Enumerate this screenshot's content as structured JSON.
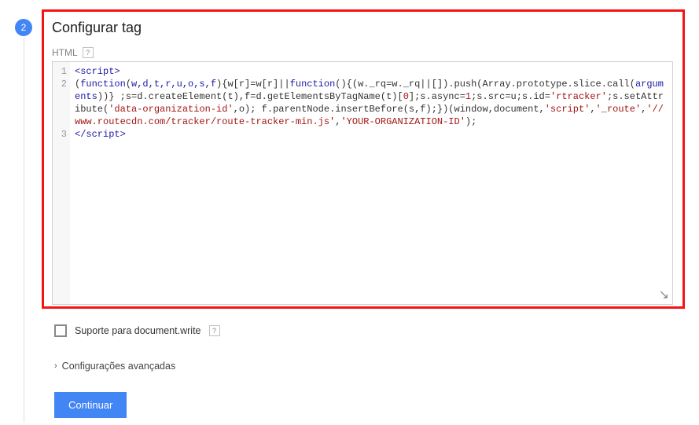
{
  "step_number": "2",
  "title": "Configurar tag",
  "html_label": "HTML",
  "help_glyph": "?",
  "code": {
    "line1": {
      "open": "<script>"
    },
    "line2": {
      "p1": "(",
      "kw1": "function",
      "p2": "(",
      "args": "w,d,t,r,u,o,s,f",
      "p3": "){w[r]=w[r]||",
      "kw2": "function",
      "p4": "(){(w._rq=w._rq||[]).push(Array.prototype.slice.call(",
      "arg_kw": "arguments",
      "p5": "))} ;s=d.createElement(t),f=d.getElementsByTagName(t)[",
      "num0": "0",
      "p5b": "];s.async=",
      "num1": "1",
      "p5c": ";s.src=u;s.id=",
      "str1": "'rtracker'",
      "p6": ";s.setAttribute(",
      "str2": "'data-organization-id'",
      "p7": ",o); f.parentNode.insertBefore(s,f);})(window,document,",
      "str3": "'script'",
      "p8": ",",
      "str4": "'_route'",
      "p9": ",",
      "str5": "'//www.routecdn.com/tracker/route-tracker-min.js'",
      "p10": ",",
      "str6": "'YOUR-ORGANIZATION-ID'",
      "p11": ");"
    },
    "line3": {
      "close": "</script>"
    }
  },
  "gutter": {
    "l1": "1",
    "l2": "2",
    "l3": "3"
  },
  "resize_glyph": "↘",
  "checkbox_label": "Suporte para document.write",
  "advanced_label": "Configurações avançadas",
  "chevron_glyph": "›",
  "continue_label": "Continuar"
}
